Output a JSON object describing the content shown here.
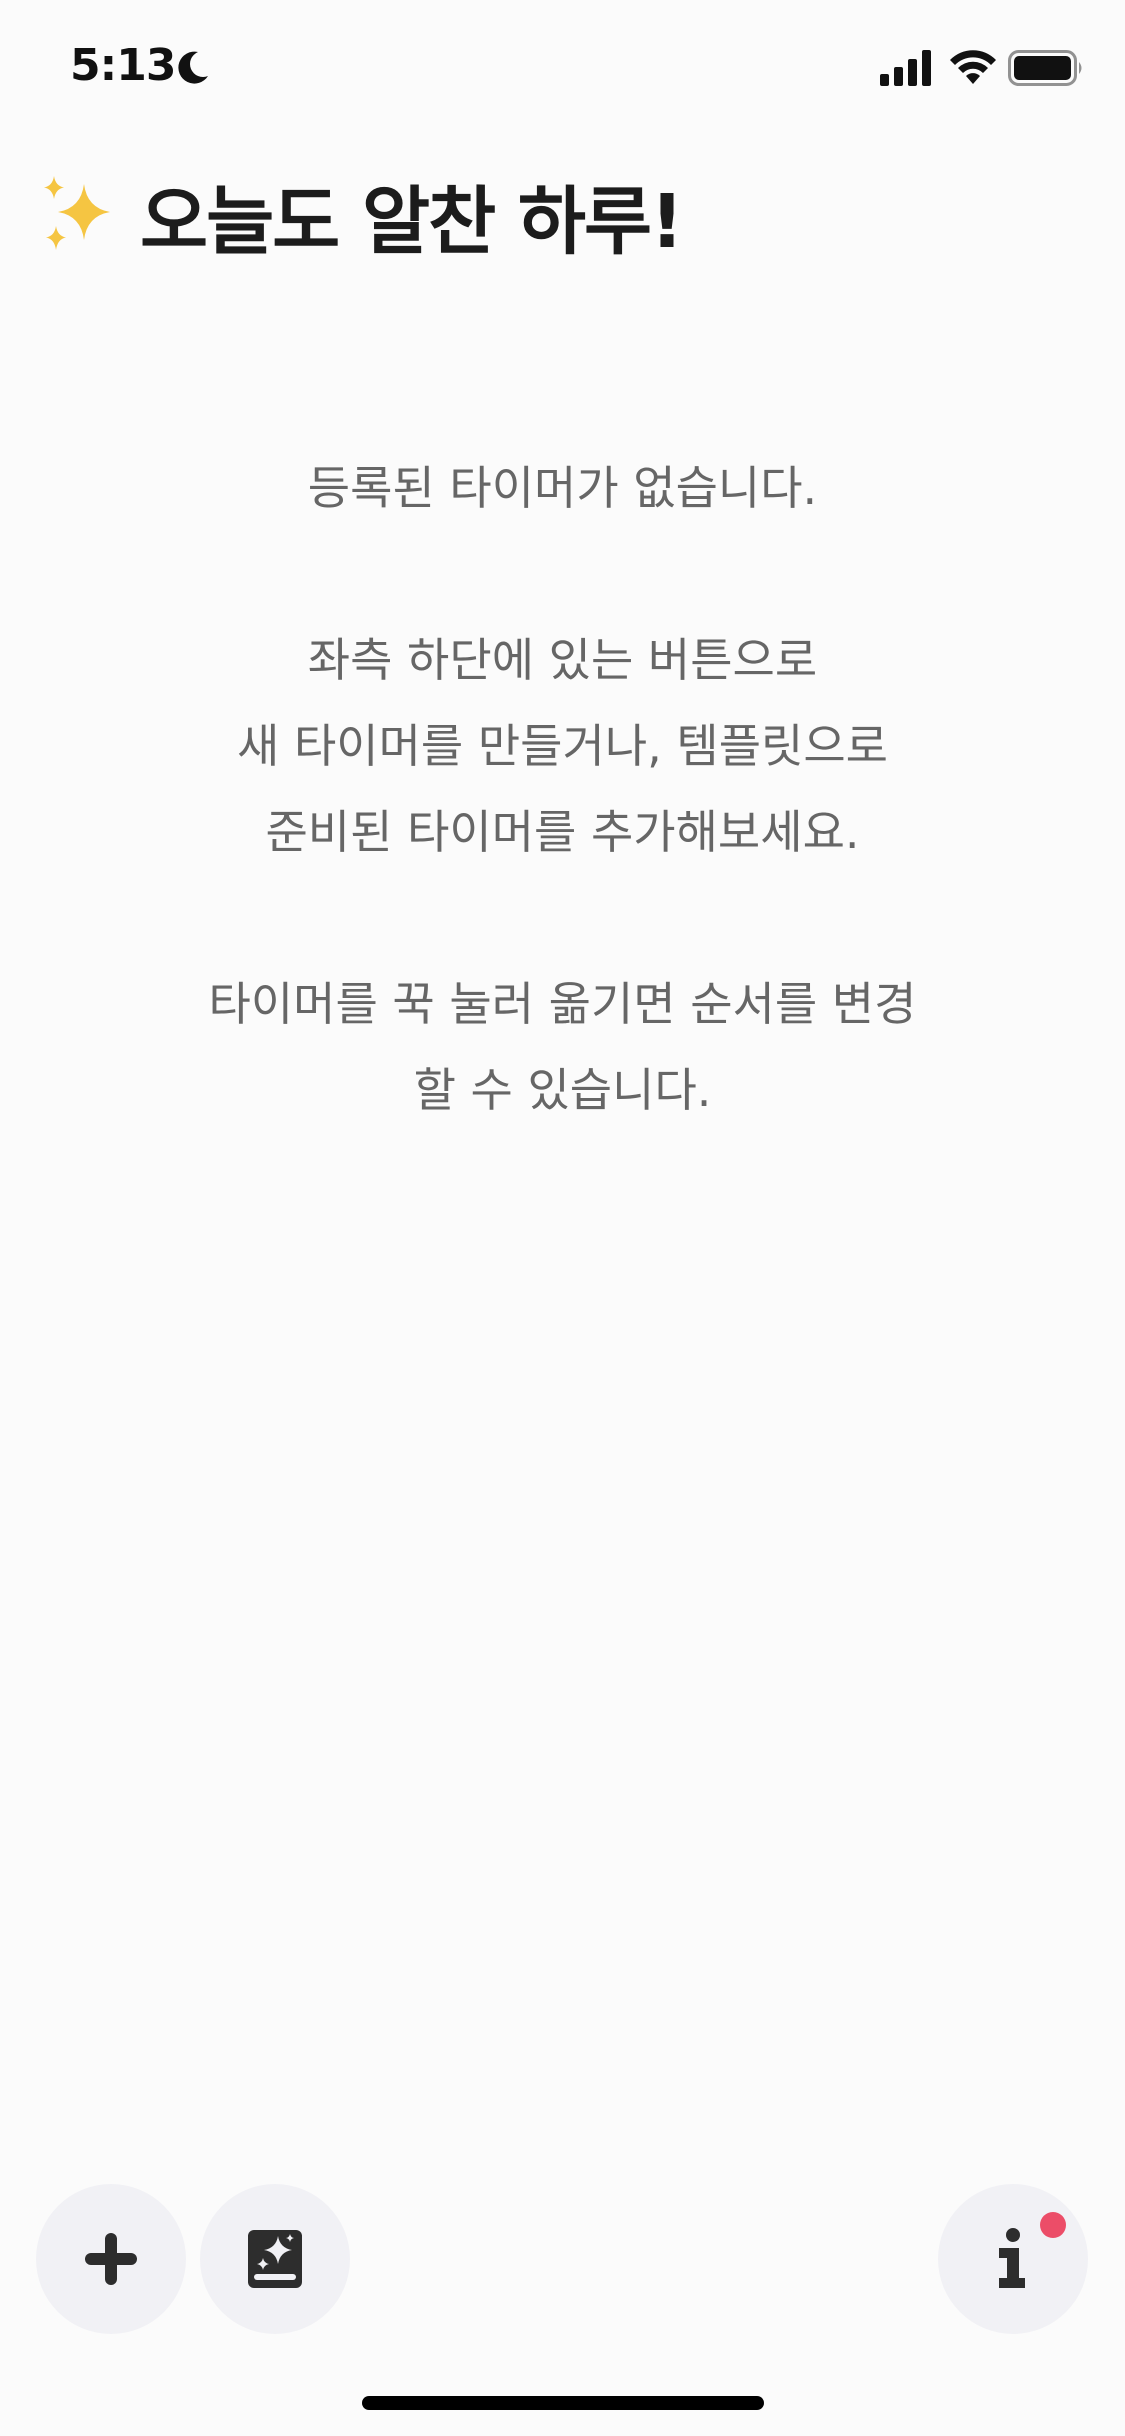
{
  "status_bar": {
    "time": "5:13",
    "icons": [
      "moon-icon",
      "signal-icon",
      "wifi-icon",
      "battery-icon"
    ]
  },
  "header": {
    "emoji_icon": "sparkles-icon",
    "title": "오늘도 알찬 하루!"
  },
  "empty_state": {
    "line1": "등록된 타이머가 없습니다.",
    "line2": "좌측 하단에 있는 버튼으로",
    "line3": "새 타이머를 만들거나, 템플릿으로",
    "line4": "준비된 타이머를 추가해보세요.",
    "line5": "타이머를 꾹 눌러 옮기면 순서를 변경",
    "line6": "할 수 있습니다."
  },
  "bottom_actions": {
    "add_icon": "plus-icon",
    "templates_icon": "template-book-icon",
    "info_icon": "info-icon",
    "info_has_notification": true
  },
  "colors": {
    "background": "#fbfbfb",
    "button_bg": "#f1f1f5",
    "notification": "#ec4d68",
    "sparkle": "#f5c542",
    "message_text": "#666666"
  }
}
